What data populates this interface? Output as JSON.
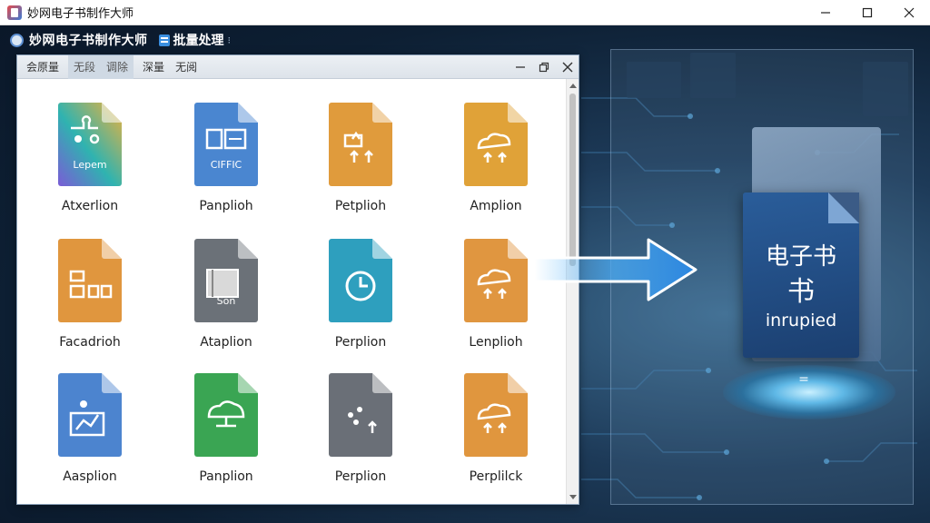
{
  "window": {
    "title": "妙网电子书制作大师",
    "controls": {
      "minimize": "minimize-icon",
      "maximize": "maximize-icon",
      "close": "close-icon"
    }
  },
  "toolbar": {
    "app_name": "妙网电子书制作大师",
    "batch_label": "批量处理",
    "more_glyph": "⁝"
  },
  "dialog": {
    "tabs": [
      {
        "label": "会原量",
        "active": false
      },
      {
        "label": "无段",
        "active": true
      },
      {
        "label": "调除",
        "active": true
      },
      {
        "label": "深量",
        "active": false
      },
      {
        "label": "无阅",
        "active": false
      }
    ]
  },
  "files": [
    {
      "label": "Atxerlion",
      "caption": "Lepem",
      "color": "rainbow",
      "icon": "puzzle-icon"
    },
    {
      "label": "Panplioh",
      "caption": "CIFFIC",
      "color": "#4a86d0",
      "icon": "book-pages-icon"
    },
    {
      "label": "Petplioh",
      "caption": "",
      "color": "#e09b3c",
      "icon": "upload-arrows-icon"
    },
    {
      "label": "Amplion",
      "caption": "",
      "color": "#e0a238",
      "icon": "cloud-up-icon"
    },
    {
      "label": "Facadrioh",
      "caption": "",
      "color": "#e0963e",
      "icon": "layout-blocks-icon"
    },
    {
      "label": "Ataplion",
      "caption": "Son",
      "color": "#6b7178",
      "icon": "document-page-icon"
    },
    {
      "label": "Perplion",
      "caption": "",
      "color": "#2e9fbe",
      "icon": "refresh-clock-icon"
    },
    {
      "label": "Lenplioh",
      "caption": "",
      "color": "#e09640",
      "icon": "cloud-up-icon"
    },
    {
      "label": "Aasplion",
      "caption": "",
      "color": "#4c84cf",
      "icon": "chart-user-icon"
    },
    {
      "label": "Panplion",
      "caption": "",
      "color": "#3aa553",
      "icon": "cloud-monitor-icon"
    },
    {
      "label": "Perplion",
      "caption": "",
      "color": "#6a6f77",
      "icon": "sparkle-arrow-icon"
    },
    {
      "label": "Perplilck",
      "caption": "",
      "color": "#e0963e",
      "icon": "cloud-up-icon"
    }
  ],
  "ebook": {
    "title_line1": "电子书",
    "title_line2": "书",
    "subtitle": "inrupied",
    "pedestal_mark": "="
  }
}
